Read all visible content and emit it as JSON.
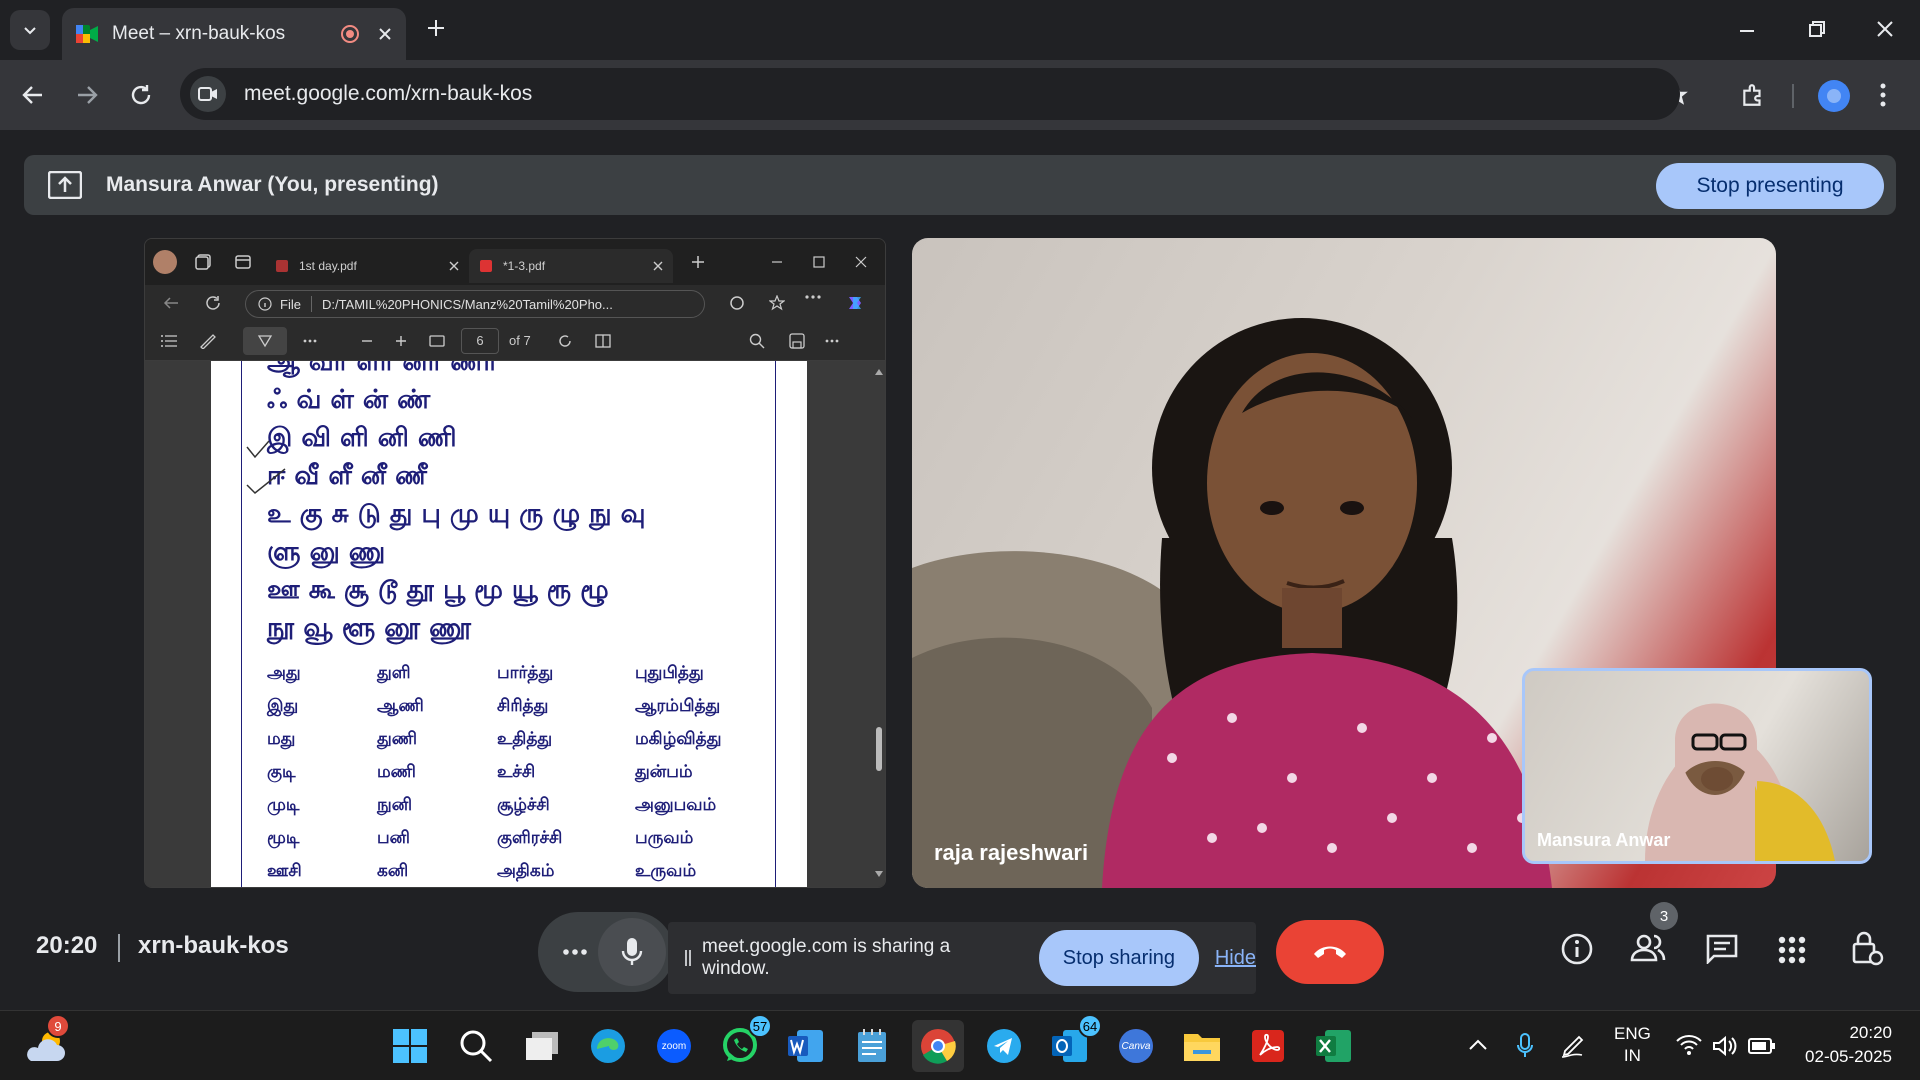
{
  "browser": {
    "tab_title": "Meet – xrn-bauk-kos",
    "url": "meet.google.com/xrn-bauk-kos"
  },
  "banner": {
    "text": "Mansura Anwar (You, presenting)",
    "stop_label": "Stop presenting"
  },
  "pdf": {
    "tabs": [
      "1st day.pdf",
      "*1-3.pdf"
    ],
    "addr_prefix": "File",
    "url": "D:/TAMIL%20PHONICS/Manz%20Tamil%20Pho...",
    "page_num": "6",
    "page_total": "of 7",
    "rows": [
      "ஆ  வா ளா னா ணா",
      "ஃ   வ் ள் ன்  ண்",
      "இ   வி ளி னி  ணி",
      "ஈ   வீ ளீ னீ  ணீ",
      "உ   கு சு டு து பு மு யு ரு ழு நு வு",
      "      ளு னு ணு",
      "ஊ  கூ சூ டூ தூ பூ மூ யூ ரூ ழூ",
      "      நூ வூ ளூ னூ ணூ"
    ],
    "words": [
      [
        "அது",
        "துளி",
        "பார்த்து",
        "புதுபித்து"
      ],
      [
        "இது",
        "ஆணி",
        "சிரித்து",
        "ஆரம்பித்து"
      ],
      [
        "மது",
        "துணி",
        "உதித்து",
        "மகிழ்வித்து"
      ],
      [
        "குடி",
        "மணி",
        "உச்சி",
        "துன்பம்"
      ],
      [
        "முடி",
        "நுனி",
        "சூழ்ச்சி",
        "அனுபவம்"
      ],
      [
        "மூடி",
        "பனி",
        "குளிரச்சி",
        "பருவம்"
      ],
      [
        "ஊசி",
        "கனி",
        "அதிகம்",
        "உருவம்"
      ]
    ]
  },
  "participants": {
    "main_name": "raja rajeshwari",
    "self_name": "Mansura Anwar",
    "count": "3"
  },
  "meeting": {
    "time": "20:20",
    "code": "xrn-bauk-kos",
    "share_msg": "meet.google.com is sharing a window.",
    "stop_sharing": "Stop sharing",
    "hide": "Hide"
  },
  "taskbar": {
    "weather_badge": "9",
    "whatsapp_badge": "57",
    "outlook_badge": "64",
    "zoom_label": "zoom",
    "canva_label": "Canva",
    "lang_top": "ENG",
    "lang_bottom": "IN",
    "clock_time": "20:20",
    "clock_date": "02-05-2025"
  }
}
